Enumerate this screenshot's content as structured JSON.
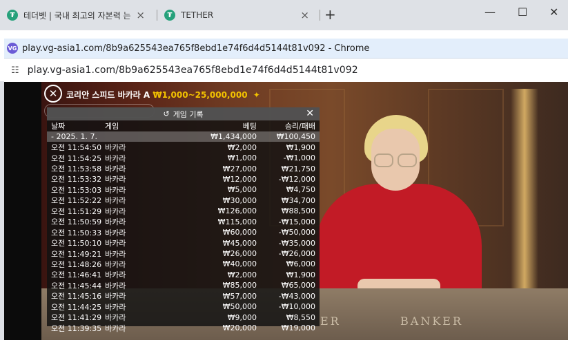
{
  "tabs": [
    {
      "title": "테더벳 | 국내 최고의 자본력 는",
      "favicon": "₮"
    },
    {
      "title": "TETHER",
      "favicon": "₮"
    }
  ],
  "popup": {
    "title": "play.vg-asia1.com/8b9a625543ea765f8ebd1e74f6d4d5144t81v092 - Chrome",
    "favicon": "VG",
    "url": "play.vg-asia1.com/8b9a625543ea765f8ebd1e74f6d4d5144t81v092"
  },
  "game": {
    "name": "코리안 스피드 바카라 A",
    "limit": "₩1,000~25,000,000",
    "table_label_banker": "BANKER",
    "table_label_player": "ER"
  },
  "history": {
    "title": "게임 기록",
    "columns": {
      "date": "날짜",
      "game": "게임",
      "bet": "베팅",
      "win": "승리/패배"
    },
    "date_group": {
      "date": "- 2025. 1. 7.",
      "bet": "₩1,434,000",
      "win": "₩100,450"
    },
    "rows": [
      {
        "time": "오전 11:54:50",
        "game": "바카라",
        "bet": "₩2,000",
        "win": "₩1,900"
      },
      {
        "time": "오전 11:54:25",
        "game": "바카라",
        "bet": "₩1,000",
        "win": "-₩1,000"
      },
      {
        "time": "오전 11:53:58",
        "game": "바카라",
        "bet": "₩27,000",
        "win": "₩21,750"
      },
      {
        "time": "오전 11:53:32",
        "game": "바카라",
        "bet": "₩12,000",
        "win": "-₩12,000"
      },
      {
        "time": "오전 11:53:03",
        "game": "바카라",
        "bet": "₩5,000",
        "win": "₩4,750"
      },
      {
        "time": "오전 11:52:22",
        "game": "바카라",
        "bet": "₩30,000",
        "win": "₩34,700"
      },
      {
        "time": "오전 11:51:29",
        "game": "바카라",
        "bet": "₩126,000",
        "win": "₩88,500"
      },
      {
        "time": "오전 11:50:59",
        "game": "바카라",
        "bet": "₩115,000",
        "win": "-₩15,000"
      },
      {
        "time": "오전 11:50:33",
        "game": "바카라",
        "bet": "₩60,000",
        "win": "-₩50,000"
      },
      {
        "time": "오전 11:50:10",
        "game": "바카라",
        "bet": "₩45,000",
        "win": "-₩35,000"
      },
      {
        "time": "오전 11:49:21",
        "game": "바카라",
        "bet": "₩26,000",
        "win": "-₩26,000"
      },
      {
        "time": "오전 11:48:26",
        "game": "바카라",
        "bet": "₩40,000",
        "win": "₩6,000"
      },
      {
        "time": "오전 11:46:41",
        "game": "바카라",
        "bet": "₩2,000",
        "win": "₩1,900"
      },
      {
        "time": "오전 11:45:44",
        "game": "바카라",
        "bet": "₩85,000",
        "win": "₩65,000"
      },
      {
        "time": "오전 11:45:16",
        "game": "바카라",
        "bet": "₩57,000",
        "win": "-₩43,000"
      },
      {
        "time": "오전 11:44:25",
        "game": "바카라",
        "bet": "₩50,000",
        "win": "-₩10,000"
      },
      {
        "time": "오전 11:41:29",
        "game": "바카라",
        "bet": "₩9,000",
        "win": "₩8,550"
      },
      {
        "time": "오전 11:39:35",
        "game": "바카라",
        "bet": "₩20,000",
        "win": "₩19,000"
      }
    ]
  },
  "icons": {
    "tab_close": "×",
    "new_tab": "+",
    "minimize": "—",
    "maximize": "☐",
    "window_close": "✕",
    "site_settings": "☷",
    "history_clock": "↺",
    "panel_close": "✕",
    "game_close": "✕",
    "star": "✦"
  }
}
